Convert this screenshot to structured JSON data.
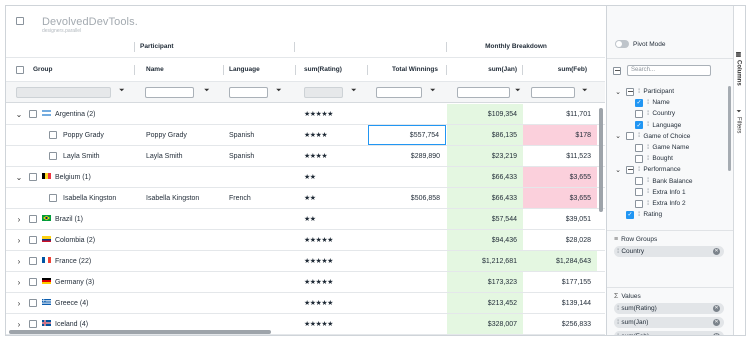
{
  "title_overlay": {
    "watermark": "DevolvedDevTools.",
    "watermark_sub": "designers.parallel"
  },
  "header_groups": {
    "participant": "Participant",
    "monthly": "Monthly Breakdown"
  },
  "columns": {
    "group": "Group",
    "name": "Name",
    "language": "Language",
    "rating": "sum(Rating)",
    "total": "Total Winnings",
    "jan": "sum(Jan)",
    "feb": "sum(Feb)"
  },
  "icons": {
    "filter": "filter-icon",
    "expand": "chevron-right-icon",
    "collapse": "chevron-down-icon"
  },
  "colors": {
    "accent": "#2196f3",
    "positive": "#e4f7e1",
    "negative": "#fbd0dc"
  },
  "rows": [
    {
      "type": "group",
      "expanded": true,
      "flag": "ar",
      "label": "Argentina (2)",
      "rating": "★★★★★",
      "total": "",
      "jan": "$109,354",
      "feb": "$11,701",
      "jan_color": "green",
      "feb_color": ""
    },
    {
      "type": "leaf",
      "group": "Poppy Grady",
      "name": "Poppy Grady",
      "language": "Spanish",
      "rating": "★★★★",
      "total": "$557,754",
      "jan": "$86,135",
      "feb": "$178",
      "jan_color": "green",
      "feb_color": "pink",
      "selected_total": true
    },
    {
      "type": "leaf",
      "group": "Layla Smith",
      "name": "Layla Smith",
      "language": "Spanish",
      "rating": "★★★★",
      "total": "$289,890",
      "jan": "$23,219",
      "feb": "$11,523",
      "jan_color": "green",
      "feb_color": ""
    },
    {
      "type": "group",
      "expanded": true,
      "flag": "be",
      "label": "Belgium (1)",
      "rating": "★★",
      "total": "",
      "jan": "$66,433",
      "feb": "$3,655",
      "jan_color": "green",
      "feb_color": "pink"
    },
    {
      "type": "leaf",
      "group": "Isabella Kingston",
      "name": "Isabella Kingston",
      "language": "French",
      "rating": "★★",
      "total": "$506,858",
      "jan": "$66,433",
      "feb": "$3,655",
      "jan_color": "green",
      "feb_color": "pink"
    },
    {
      "type": "group",
      "expanded": false,
      "flag": "br",
      "label": "Brazil (1)",
      "rating": "★★",
      "total": "",
      "jan": "$57,544",
      "feb": "$39,051",
      "jan_color": "green",
      "feb_color": ""
    },
    {
      "type": "group",
      "expanded": false,
      "flag": "co",
      "label": "Colombia (2)",
      "rating": "★★★★★",
      "total": "",
      "jan": "$94,436",
      "feb": "$28,028",
      "jan_color": "green",
      "feb_color": ""
    },
    {
      "type": "group",
      "expanded": false,
      "flag": "fr",
      "label": "France (22)",
      "rating": "★★★★★",
      "total": "",
      "jan": "$1,212,681",
      "feb": "$1,284,643",
      "jan_color": "green",
      "feb_color": "green"
    },
    {
      "type": "group",
      "expanded": false,
      "flag": "de",
      "label": "Germany (3)",
      "rating": "★★★★★",
      "total": "",
      "jan": "$173,323",
      "feb": "$177,155",
      "jan_color": "green",
      "feb_color": ""
    },
    {
      "type": "group",
      "expanded": false,
      "flag": "gr",
      "label": "Greece (4)",
      "rating": "★★★★★",
      "total": "",
      "jan": "$213,452",
      "feb": "$139,144",
      "jan_color": "green",
      "feb_color": ""
    },
    {
      "type": "group",
      "expanded": false,
      "flag": "is",
      "label": "Iceland (4)",
      "rating": "★★★★★",
      "total": "",
      "jan": "$328,007",
      "feb": "$256,833",
      "jan_color": "green",
      "feb_color": ""
    }
  ],
  "side": {
    "pivot_mode": "Pivot Mode",
    "search_placeholder": "Search...",
    "tree": [
      {
        "kind": "group",
        "label": "Participant",
        "state": "part"
      },
      {
        "kind": "item",
        "label": "Name",
        "state": "on"
      },
      {
        "kind": "item",
        "label": "Country",
        "state": "off"
      },
      {
        "kind": "item",
        "label": "Language",
        "state": "on"
      },
      {
        "kind": "group",
        "label": "Game of Choice",
        "state": "off"
      },
      {
        "kind": "item",
        "label": "Game Name",
        "state": "off"
      },
      {
        "kind": "item",
        "label": "Bought",
        "state": "off"
      },
      {
        "kind": "group",
        "label": "Performance",
        "state": "part"
      },
      {
        "kind": "item",
        "label": "Bank Balance",
        "state": "off"
      },
      {
        "kind": "item",
        "label": "Extra Info 1",
        "state": "off"
      },
      {
        "kind": "item",
        "label": "Extra Info 2",
        "state": "off"
      },
      {
        "kind": "root",
        "label": "Rating",
        "state": "on"
      }
    ],
    "row_groups_title": "Row Groups",
    "row_groups": [
      "Country"
    ],
    "values_title": "Values",
    "values": [
      "sum(Rating)",
      "sum(Jan)",
      "sum(Feb)"
    ],
    "tab_columns": "Columns",
    "tab_filters": "Filters"
  }
}
